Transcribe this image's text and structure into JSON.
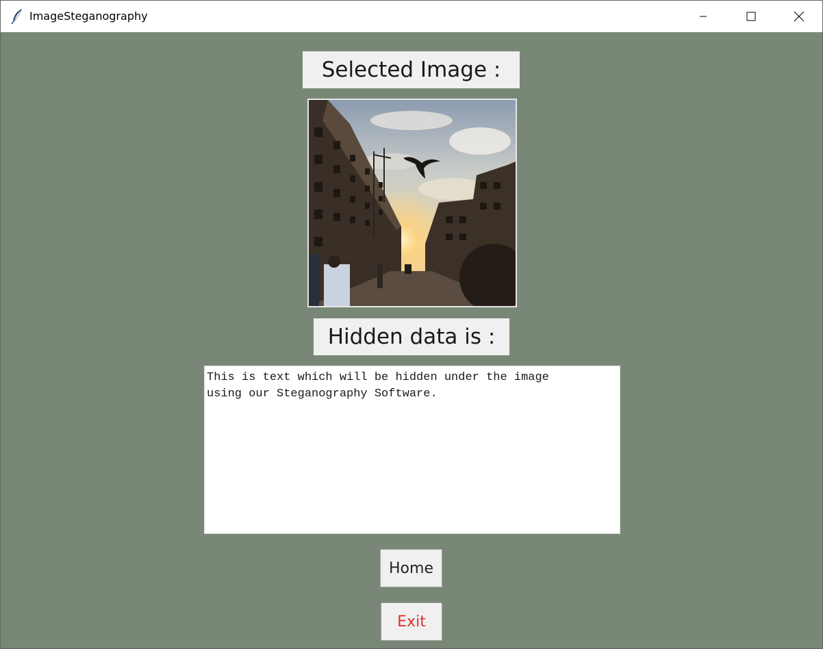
{
  "window": {
    "title": "ImageSteganography",
    "app_icon": "feather-icon",
    "controls": {
      "minimize": "minimize-icon",
      "maximize": "maximize-icon",
      "close": "close-icon"
    }
  },
  "main": {
    "selected_image_label": "Selected Image :",
    "hidden_data_label": "Hidden data is :",
    "hidden_text": "This is text which will be hidden under the image\nusing our Steganography Software.",
    "home_button": "Home",
    "exit_button": "Exit"
  },
  "colors": {
    "background": "#798876",
    "label_bg": "#f0f0f0",
    "exit_text": "#e03030"
  }
}
